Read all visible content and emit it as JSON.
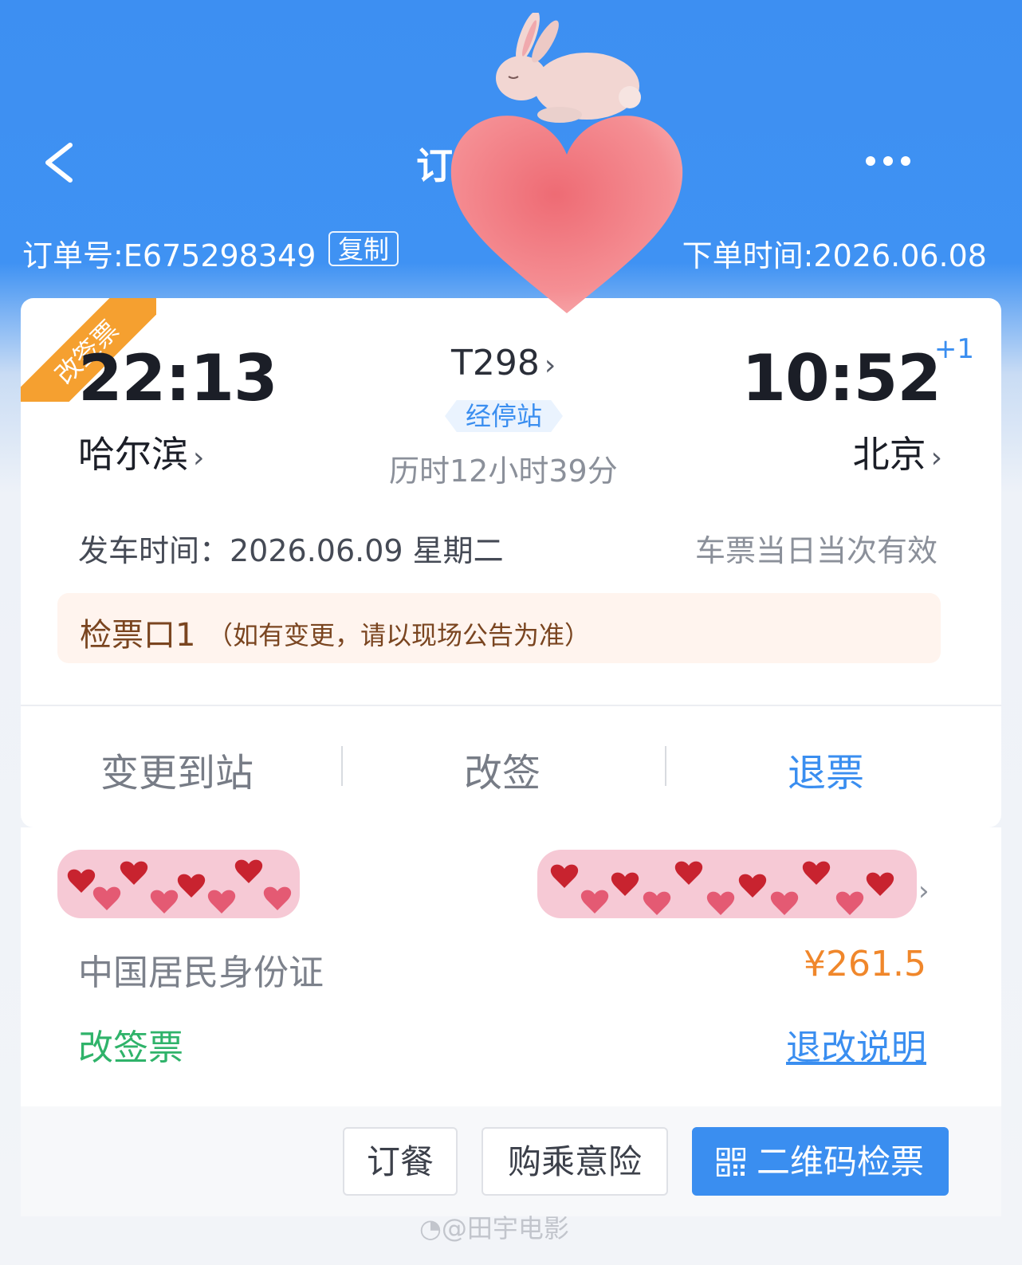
{
  "header": {
    "title": "订",
    "order_no": "订单号:E675298349",
    "copy_label": "复制",
    "order_time": "下单时间:2026.06.08"
  },
  "trip": {
    "ribbon": "改签票",
    "departure_time": "22:13",
    "departure_station": "哈尔滨",
    "train_no": "T298",
    "stops_label": "经停站",
    "duration": "历时12小时39分",
    "arrival_time": "10:52",
    "arrival_day_offset": "+1",
    "arrival_station": "北京",
    "depart_date": "发车时间：2026.06.09 星期二",
    "validity": "车票当日当次有效",
    "gate": "检票口1",
    "gate_note": "（如有变更，请以现场公告为准）"
  },
  "actions": {
    "change_station": "变更到站",
    "reschedule": "改签",
    "refund": "退票"
  },
  "passenger": {
    "id_type": "中国居民身份证",
    "price": "¥261.5",
    "ticket_type": "改签票",
    "refund_rules": "退改说明"
  },
  "bottom_bar": {
    "meal": "订餐",
    "insurance": "购乘意险",
    "qr_check": "二维码检票"
  },
  "watermark": "@田宇电影",
  "colors": {
    "header_blue": "#3d8ff2",
    "accent_blue": "#3a8ef0",
    "price_orange": "#f0872b",
    "ribbon_orange": "#f5a030",
    "ticket_green": "#2fb36a"
  },
  "icons": [
    "back-icon",
    "more-icon",
    "chevron-right-icon",
    "qr-code-icon",
    "weibo-icon"
  ]
}
